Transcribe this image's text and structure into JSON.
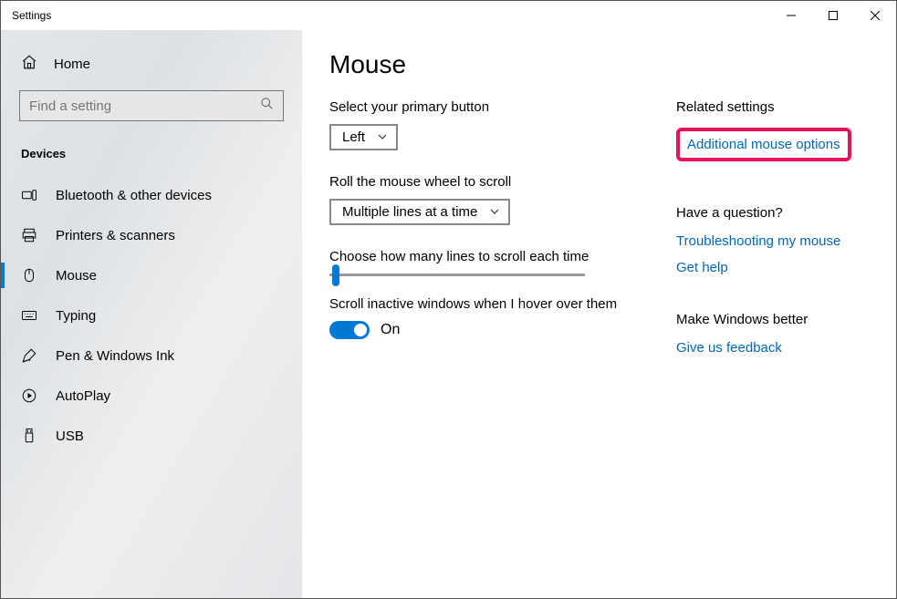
{
  "window": {
    "title": "Settings"
  },
  "sidebar": {
    "home": "Home",
    "search_placeholder": "Find a setting",
    "section": "Devices",
    "items": [
      {
        "label": "Bluetooth & other devices"
      },
      {
        "label": "Printers & scanners"
      },
      {
        "label": "Mouse"
      },
      {
        "label": "Typing"
      },
      {
        "label": "Pen & Windows Ink"
      },
      {
        "label": "AutoPlay"
      },
      {
        "label": "USB"
      }
    ]
  },
  "main": {
    "heading": "Mouse",
    "primary_label": "Select your primary button",
    "primary_value": "Left",
    "roll_label": "Roll the mouse wheel to scroll",
    "roll_value": "Multiple lines at a time",
    "lines_label": "Choose how many lines to scroll each time",
    "hover_label": "Scroll inactive windows when I hover over them",
    "hover_value": "On"
  },
  "aside": {
    "related_head": "Related settings",
    "related_link": "Additional mouse options",
    "question_head": "Have a question?",
    "question_links": [
      "Troubleshooting my mouse",
      "Get help"
    ],
    "better_head": "Make Windows better",
    "better_link": "Give us feedback"
  }
}
